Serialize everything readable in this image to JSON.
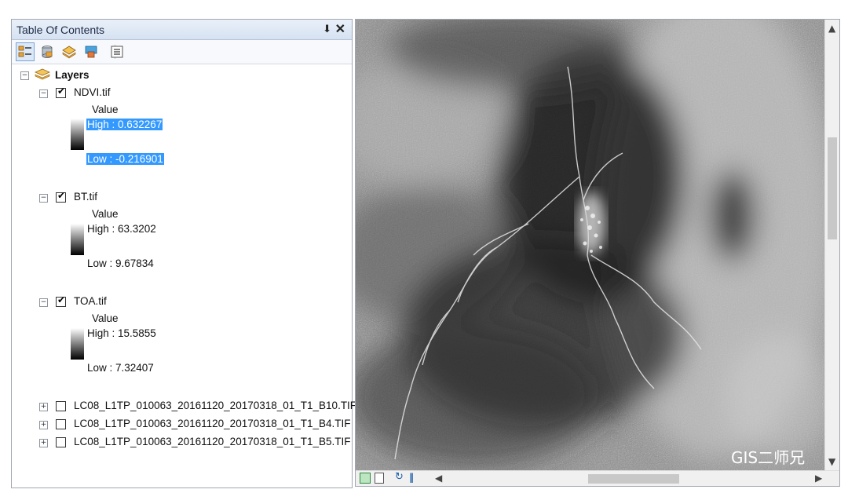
{
  "toc": {
    "title": "Table Of Contents",
    "pin_glyph": "⬇",
    "close_glyph": "✕",
    "toolbar": [
      "list-by-drawing-order-icon",
      "list-by-source-icon",
      "list-by-visibility-icon",
      "list-by-selection-icon",
      "options-icon"
    ],
    "root_label": "Layers",
    "expander_minus": "−",
    "expander_plus": "+",
    "check_glyph": "✔",
    "layers": [
      {
        "name": "NDVI.tif",
        "checked": true,
        "expanded": true,
        "field": "Value",
        "high": "High : 0.632267",
        "low": "Low : -0.216901",
        "highlighted": true
      },
      {
        "name": "BT.tif",
        "checked": true,
        "expanded": true,
        "field": "Value",
        "high": "High : 63.3202",
        "low": "Low : 9.67834"
      },
      {
        "name": "TOA.tif",
        "checked": true,
        "expanded": true,
        "field": "Value",
        "high": "High : 15.5855",
        "low": "Low : 7.32407"
      },
      {
        "name": "LC08_L1TP_010063_20161120_20170318_01_T1_B10.TIF",
        "checked": false,
        "expanded": false
      },
      {
        "name": "LC08_L1TP_010063_20161120_20170318_01_T1_B4.TIF",
        "checked": false,
        "expanded": false
      },
      {
        "name": "LC08_L1TP_010063_20161120_20170318_01_T1_B5.TIF",
        "checked": false,
        "expanded": false
      }
    ]
  },
  "map": {
    "watermark": "GIS二师兄",
    "scroll_up": "▲",
    "scroll_down": "▼",
    "scroll_left": "◀",
    "scroll_right": "▶",
    "layout_view_icon": "layout-view-icon",
    "data_view_icon": "data-view-icon",
    "refresh_icon": "refresh-icon",
    "pause_icon": "pause-icon",
    "refresh_glyph": "↻",
    "pause_glyph": "‖"
  }
}
